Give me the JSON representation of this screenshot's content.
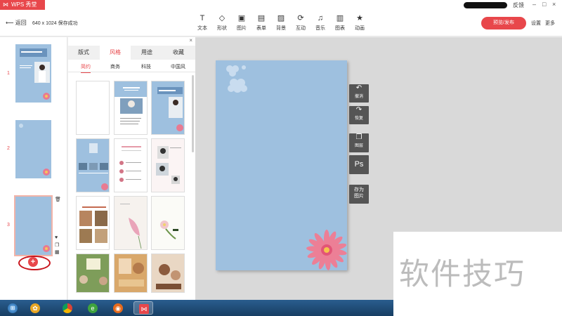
{
  "app": {
    "name": "WPS 秀堂",
    "feedback": "反馈"
  },
  "toolbar": {
    "back": "返回",
    "status": "640 x 1024  保存成功",
    "tools": [
      {
        "label": "文本",
        "icon": "text-icon"
      },
      {
        "label": "形状",
        "icon": "shape-icon"
      },
      {
        "label": "图片",
        "icon": "image-icon"
      },
      {
        "label": "表单",
        "icon": "form-icon"
      },
      {
        "label": "背景",
        "icon": "background-icon"
      },
      {
        "label": "互动",
        "icon": "interaction-icon"
      },
      {
        "label": "音乐",
        "icon": "music-icon"
      },
      {
        "label": "图表",
        "icon": "chart-icon"
      },
      {
        "label": "动画",
        "icon": "animation-icon"
      }
    ],
    "publish": "预览/发布",
    "settings": "设置",
    "more": "更多"
  },
  "pages": [
    {
      "number": "1"
    },
    {
      "number": "2"
    },
    {
      "number": "3"
    }
  ],
  "panel": {
    "tabs": [
      "版式",
      "风格",
      "用途",
      "收藏"
    ],
    "active_tab": "风格",
    "subtabs": [
      "简约",
      "商务",
      "科技",
      "中国风"
    ],
    "active_subtab": "简约"
  },
  "side_buttons": [
    {
      "label": "撤消",
      "icon": "undo-icon"
    },
    {
      "label": "恢复",
      "icon": "redo-icon"
    },
    {
      "label": "图层",
      "icon": "layers-icon"
    },
    {
      "label": "Ps",
      "icon": "photoshop-icon"
    },
    {
      "label": "存为图片",
      "icon": "save-image-icon"
    }
  ],
  "watermark": "软件技巧",
  "colors": {
    "accent": "#e8474b",
    "slide_bg": "#9ec0df",
    "canvas_bg": "#d9d9d9"
  }
}
